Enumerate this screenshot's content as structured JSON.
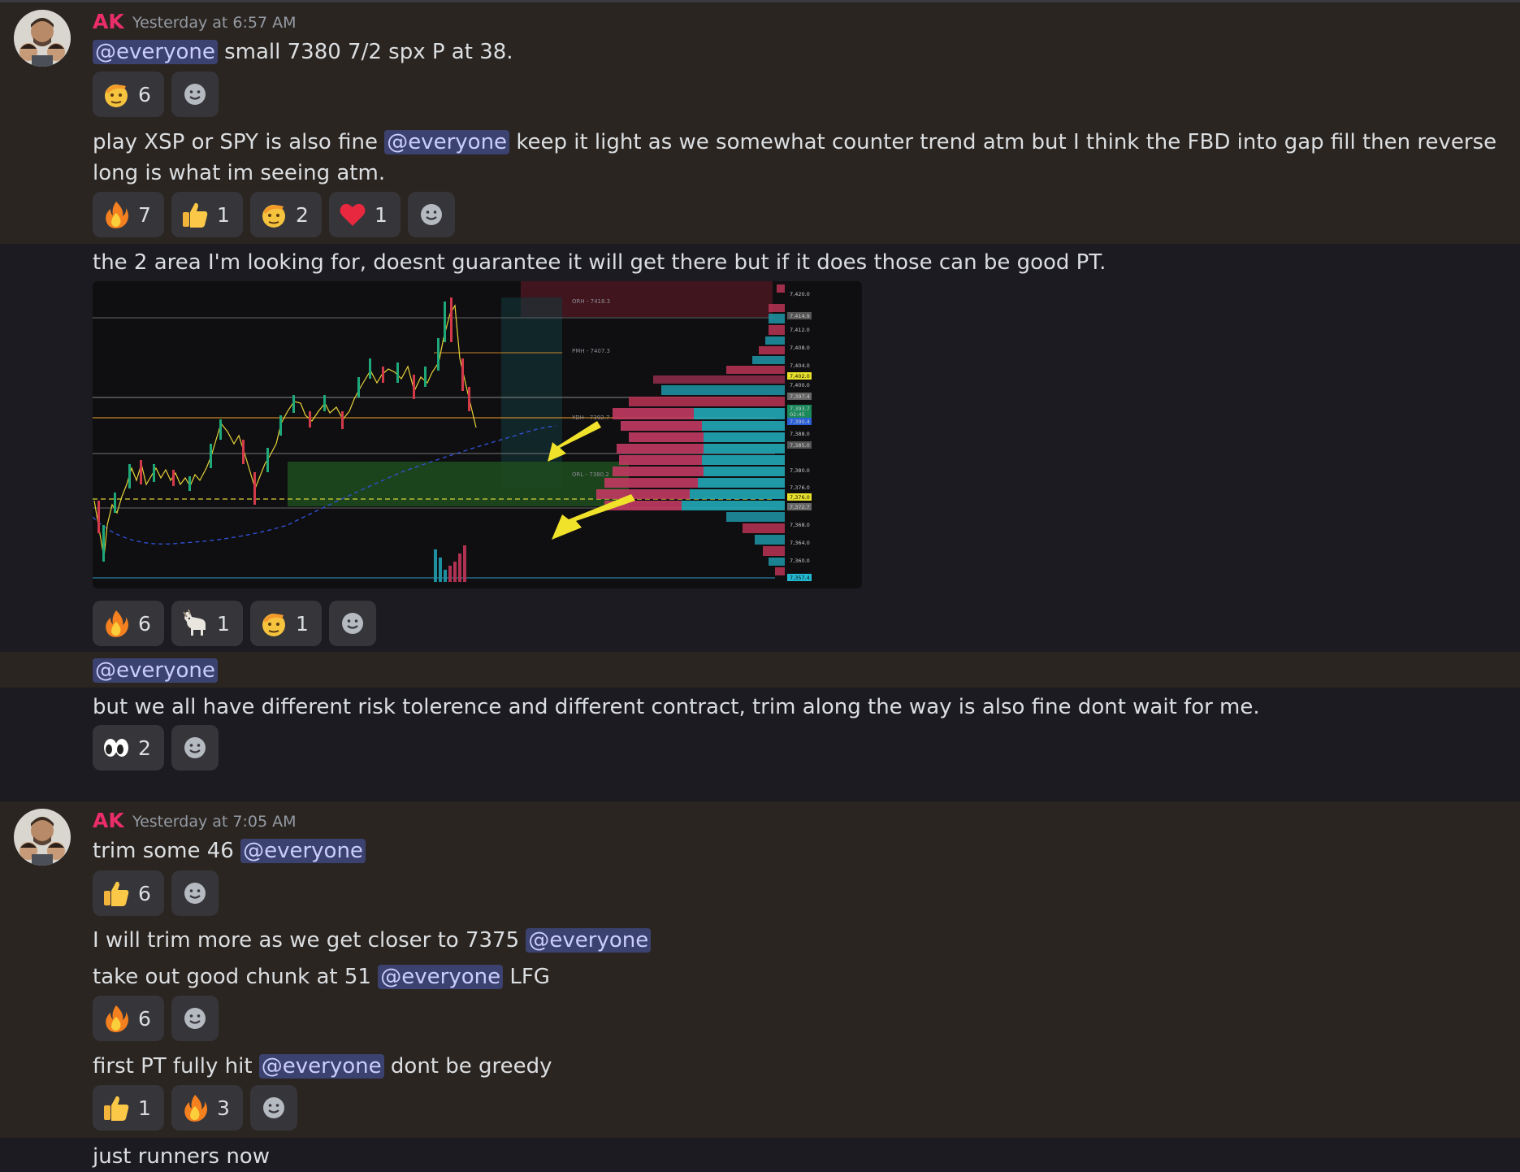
{
  "messages": [
    {
      "author": "AK",
      "timestamp": "Yesterday at 6:57 AM",
      "text1_mention": "@everyone",
      "text1_rest": " small 7380 7/2 spx P at 38.",
      "reactions1": [
        {
          "emoji": "saluting-face",
          "count": "6"
        }
      ],
      "text2_before": "play XSP or SPY is also fine ",
      "text2_mention": "@everyone",
      "text2_after": " keep it light as we somewhat counter trend atm but I think the FBD into gap fill then reverse long is what im seeing atm.",
      "reactions2": [
        {
          "emoji": "fire",
          "count": "7"
        },
        {
          "emoji": "thumbs-up",
          "count": "1"
        },
        {
          "emoji": "saluting-face",
          "count": "2"
        },
        {
          "emoji": "red-heart",
          "count": "1"
        }
      ],
      "text3": "the 2 area I'm looking for, doesnt guarantee it will get there but if it does those can be good PT.",
      "reactions3": [
        {
          "emoji": "fire",
          "count": "6"
        },
        {
          "emoji": "goat",
          "count": "1"
        },
        {
          "emoji": "saluting-face",
          "count": "1"
        }
      ],
      "text4_mention": "@everyone",
      "text5": "but we all have different risk tolerence and different contract, trim along the way is also fine dont wait for me.",
      "reactions5": [
        {
          "emoji": "eyes",
          "count": "2"
        }
      ]
    },
    {
      "author": "AK",
      "timestamp": "Yesterday at 7:05 AM",
      "text1_before": "trim some 46 ",
      "text1_mention": "@everyone",
      "reactions1": [
        {
          "emoji": "thumbs-up",
          "count": "6"
        }
      ],
      "text2_before": "I will trim more as we get closer to 7375 ",
      "text2_mention": "@everyone",
      "text3_before": "take out good chunk at 51 ",
      "text3_mention": "@everyone",
      "text3_after": " LFG",
      "reactions3": [
        {
          "emoji": "fire",
          "count": "6"
        }
      ],
      "text4_before": "first PT fully hit ",
      "text4_mention": "@everyone",
      "text4_after": " dont be greedy",
      "reactions4": [
        {
          "emoji": "thumbs-up",
          "count": "1"
        },
        {
          "emoji": "fire",
          "count": "3"
        }
      ],
      "text5": "just runners now"
    }
  ],
  "chart_image": {
    "level_labels": [
      "ORH - 7418.3",
      "PMH - 7407.3",
      "YDH - 7392.7",
      "ORL - 7380.2"
    ],
    "price_ticks": [
      "7,420.0",
      "7,414.9",
      "7,412.0",
      "7,408.0",
      "7,404.0",
      "7,402.0",
      "7,400.0",
      "7,397.4",
      "7,393.7",
      "02:45",
      "7,390.4",
      "7,388.0",
      "7,385.0",
      "7,380.0",
      "7,376.0",
      "7,372.7",
      "7,368.0",
      "7,364.0",
      "7,360.0",
      "7,357.4"
    ]
  },
  "colors": {
    "username": "#ea2d6b",
    "mention_bg": "#3c4270",
    "mention_text": "#c9cdfb"
  }
}
